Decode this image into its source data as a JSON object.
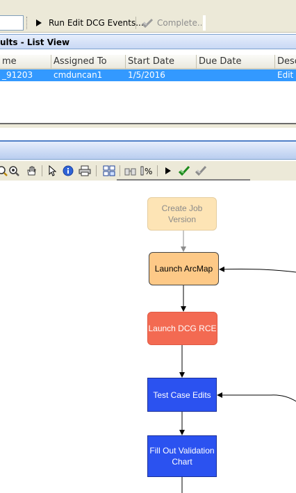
{
  "toolbar": {
    "run_label": "Run Edit DCG Events...",
    "complete_label": "Complete..."
  },
  "list_view": {
    "title": "ults - List View",
    "columns": [
      "me",
      "Assigned To",
      "Start Date",
      "Due Date",
      "Desc"
    ],
    "rows": [
      {
        "name": "_91203",
        "assigned_to": "cmduncan1",
        "start_date": "1/5/2016",
        "due_date": "",
        "description": "Edit E"
      }
    ]
  },
  "workflow": {
    "nodes": [
      {
        "label": "Create Job Version",
        "state": "completed"
      },
      {
        "label": "Launch ArcMap",
        "state": "current"
      },
      {
        "label": "Launch DCG RCE",
        "state": "pending"
      },
      {
        "label": "Test Case Edits",
        "state": "pending"
      },
      {
        "label": "Fill Out Validation Chart",
        "state": "pending"
      }
    ]
  },
  "icons": {
    "run": "play-icon",
    "complete": "checkmark-icon",
    "tools": [
      "zoom-out-icon",
      "zoom-in-icon",
      "pan-hand-icon",
      "pointer-icon",
      "info-icon",
      "print-icon",
      "layout-icon",
      "find-icon",
      "percent-icon",
      "run-step-icon",
      "complete-step-icon",
      "mark-complete-icon"
    ]
  },
  "colors": {
    "selection": "#3399ff",
    "completed_step": "#fde4b5",
    "current_step": "#fdc987",
    "launch_step": "#f36a52",
    "edit_step": "#2b52f0"
  }
}
